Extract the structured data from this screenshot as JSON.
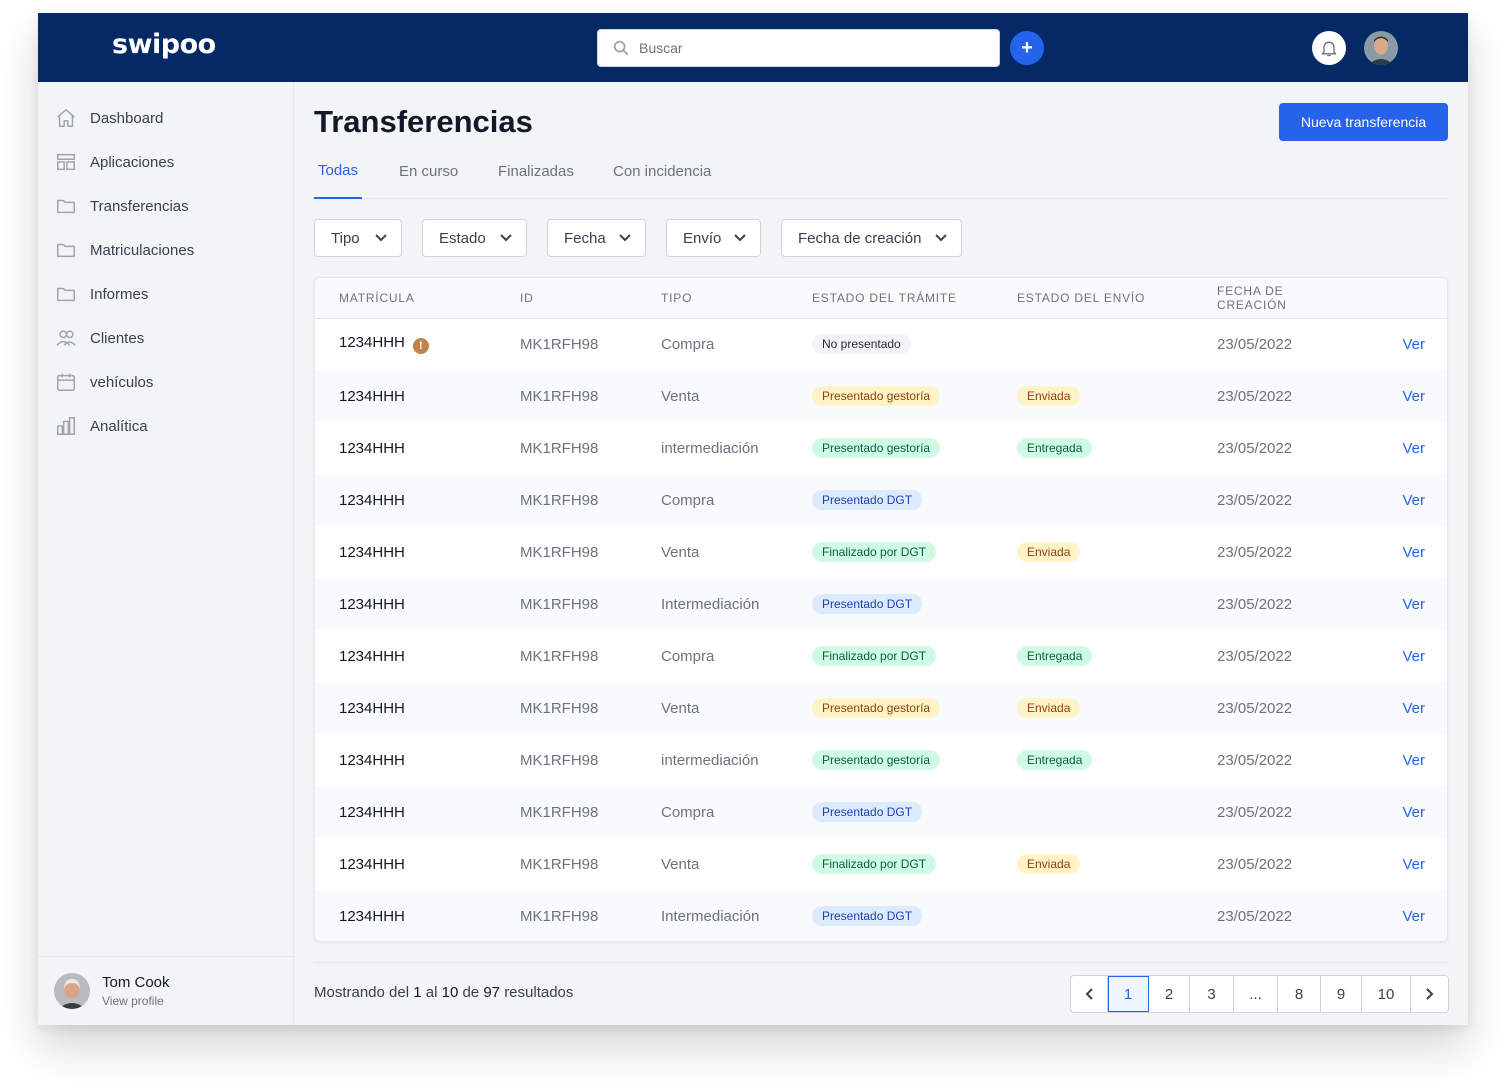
{
  "app": {
    "logo": "swipoo"
  },
  "header": {
    "search_placeholder": "Buscar",
    "add_label": "+"
  },
  "sidebar": {
    "items": [
      {
        "label": "Dashboard",
        "icon": "home-icon"
      },
      {
        "label": "Aplicaciones",
        "icon": "layout-icon"
      },
      {
        "label": "Transferencias",
        "icon": "folder-icon"
      },
      {
        "label": "Matriculaciones",
        "icon": "folder-icon"
      },
      {
        "label": "Informes",
        "icon": "folder-icon"
      },
      {
        "label": "Clientes",
        "icon": "users-icon"
      },
      {
        "label": "vehículos",
        "icon": "calendar-icon"
      },
      {
        "label": "Analítica",
        "icon": "chart-icon"
      }
    ],
    "profile": {
      "name": "Tom Cook",
      "link": "View profile"
    }
  },
  "main": {
    "title": "Transferencias",
    "primary_button": "Nueva transferencia",
    "tabs": [
      {
        "label": "Todas",
        "active": true
      },
      {
        "label": "En curso",
        "active": false
      },
      {
        "label": "Finalizadas",
        "active": false
      },
      {
        "label": "Con incidencia",
        "active": false
      }
    ],
    "filters": [
      "Tipo",
      "Estado",
      "Fecha",
      "Envío",
      "Fecha de creación"
    ],
    "table": {
      "columns": [
        "MATRÍCULA",
        "ID",
        "TIPO",
        "ESTADO DEL TRÁMITE",
        "ESTADO DEL ENVÍO",
        "FECHA DE CREACIÓN"
      ],
      "action_label": "Ver",
      "rows": [
        {
          "matricula": "1234HHH",
          "warning": "!",
          "id": "MK1RFH98",
          "tipo": "Compra",
          "tramite": "No presentado",
          "tramite_color": "gray",
          "envio": "",
          "envio_color": "",
          "fecha": "23/05/2022"
        },
        {
          "matricula": "1234HHH",
          "warning": "",
          "id": "MK1RFH98",
          "tipo": "Venta",
          "tramite": "Presentado gestoría",
          "tramite_color": "yellow",
          "envio": "Enviada",
          "envio_color": "yellow",
          "fecha": "23/05/2022"
        },
        {
          "matricula": "1234HHH",
          "warning": "",
          "id": "MK1RFH98",
          "tipo": "intermediación",
          "tramite": "Presentado gestoría",
          "tramite_color": "green",
          "envio": "Entregada",
          "envio_color": "green",
          "fecha": "23/05/2022"
        },
        {
          "matricula": "1234HHH",
          "warning": "",
          "id": "MK1RFH98",
          "tipo": "Compra",
          "tramite": "Presentado DGT",
          "tramite_color": "blue",
          "envio": "",
          "envio_color": "",
          "fecha": "23/05/2022"
        },
        {
          "matricula": "1234HHH",
          "warning": "",
          "id": "MK1RFH98",
          "tipo": "Venta",
          "tramite": "Finalizado por DGT",
          "tramite_color": "green",
          "envio": "Enviada",
          "envio_color": "yellow",
          "fecha": "23/05/2022"
        },
        {
          "matricula": "1234HHH",
          "warning": "",
          "id": "MK1RFH98",
          "tipo": "Intermediación",
          "tramite": "Presentado DGT",
          "tramite_color": "blue",
          "envio": "",
          "envio_color": "",
          "fecha": "23/05/2022"
        },
        {
          "matricula": "1234HHH",
          "warning": "",
          "id": "MK1RFH98",
          "tipo": "Compra",
          "tramite": "Finalizado por DGT",
          "tramite_color": "green",
          "envio": "Entregada",
          "envio_color": "green",
          "fecha": "23/05/2022"
        },
        {
          "matricula": "1234HHH",
          "warning": "",
          "id": "MK1RFH98",
          "tipo": "Venta",
          "tramite": "Presentado gestoría",
          "tramite_color": "yellow",
          "envio": "Enviada",
          "envio_color": "yellow",
          "fecha": "23/05/2022"
        },
        {
          "matricula": "1234HHH",
          "warning": "",
          "id": "MK1RFH98",
          "tipo": "intermediación",
          "tramite": "Presentado gestoría",
          "tramite_color": "green",
          "envio": "Entregada",
          "envio_color": "green",
          "fecha": "23/05/2022"
        },
        {
          "matricula": "1234HHH",
          "warning": "",
          "id": "MK1RFH98",
          "tipo": "Compra",
          "tramite": "Presentado DGT",
          "tramite_color": "blue",
          "envio": "",
          "envio_color": "",
          "fecha": "23/05/2022"
        },
        {
          "matricula": "1234HHH",
          "warning": "",
          "id": "MK1RFH98",
          "tipo": "Venta",
          "tramite": "Finalizado por DGT",
          "tramite_color": "green",
          "envio": "Enviada",
          "envio_color": "yellow",
          "fecha": "23/05/2022"
        },
        {
          "matricula": "1234HHH",
          "warning": "",
          "id": "MK1RFH98",
          "tipo": "Intermediación",
          "tramite": "Presentado DGT",
          "tramite_color": "blue",
          "envio": "",
          "envio_color": "",
          "fecha": "23/05/2022"
        }
      ]
    },
    "results": {
      "prefix": "Mostrando del",
      "from": "1",
      "mid1": "al",
      "to": "10",
      "mid2": "de",
      "total": "97",
      "suffix": "resultados"
    },
    "pagination": {
      "pages": [
        "1",
        "2",
        "3",
        "...",
        "8",
        "9",
        "10"
      ],
      "current": "1"
    }
  },
  "colors": {
    "brand": "#042965",
    "accent": "#2563eb"
  }
}
